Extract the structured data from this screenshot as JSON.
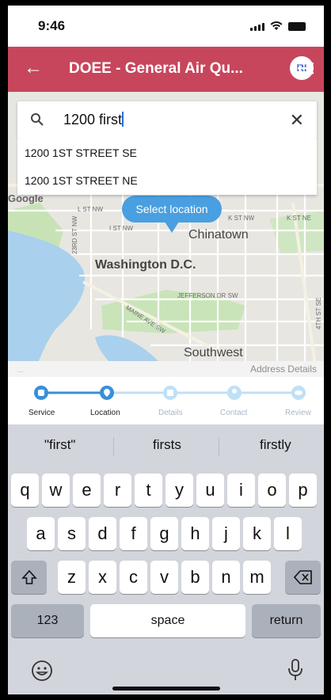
{
  "status": {
    "time": "9:46"
  },
  "header": {
    "title": "DOEE - General Air Qu...",
    "avatar": "RI",
    "back_icon": "arrow-left-icon",
    "menu_icon": "hamburger-menu-icon",
    "color": "#c7465c"
  },
  "search": {
    "value": "1200 first",
    "suggestions": [
      "1200 1ST STREET SE",
      "1200 1ST STREET NE"
    ]
  },
  "map": {
    "tooltip": "Select location",
    "labels": {
      "chinatown": "Chinatown",
      "washington": "Washington D.C.",
      "southwest": "Southwest",
      "google": "Google",
      "l_st": "L ST NW",
      "k_st": "K ST NW",
      "k_st2": "K ST NE",
      "jefferson": "JEFFERSON DR SW",
      "maine": "MAINE AVE SW",
      "third": "23RD ST NW",
      "fourth": "4TH ST SE",
      "i_st": "I ST NW"
    },
    "address_details": "Address Details"
  },
  "stepper": {
    "steps": [
      "Service",
      "Location",
      "Details",
      "Contact",
      "Review"
    ],
    "active_index": 1,
    "accent": "#3a8fd8"
  },
  "keyboard": {
    "predictions": [
      "\"first\"",
      "firsts",
      "firstly"
    ],
    "row1": [
      "q",
      "w",
      "e",
      "r",
      "t",
      "y",
      "u",
      "i",
      "o",
      "p"
    ],
    "row2": [
      "a",
      "s",
      "d",
      "f",
      "g",
      "h",
      "j",
      "k",
      "l"
    ],
    "row3": [
      "z",
      "x",
      "c",
      "v",
      "b",
      "n",
      "m"
    ],
    "numbers": "123",
    "space": "space",
    "return": "return"
  }
}
